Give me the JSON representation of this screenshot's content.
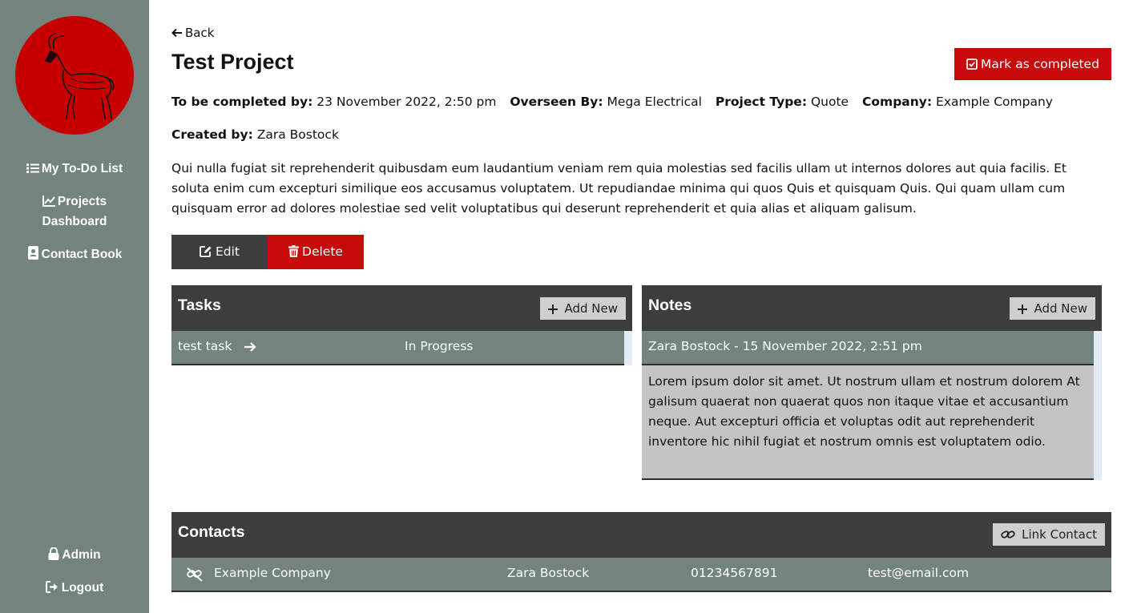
{
  "sidebar": {
    "logo_alt": "antelope-logo",
    "items": [
      {
        "label": "My To-Do List",
        "icon": "list-icon"
      },
      {
        "label_line1": "Projects",
        "label_line2": "Dashboard",
        "icon": "chart-line-icon"
      },
      {
        "label": "Contact Book",
        "icon": "address-book-icon"
      }
    ],
    "admin_label": "Admin",
    "logout_label": "Logout"
  },
  "header": {
    "back_label": "Back",
    "title": "Test Project",
    "mark_completed_label": "Mark as completed"
  },
  "meta": {
    "completed_by_label": "To be completed by:",
    "completed_by_value": "23 November 2022, 2:50 pm",
    "overseen_label": "Overseen By:",
    "overseen_value": "Mega Electrical",
    "type_label": "Project Type:",
    "type_value": "Quote",
    "company_label": "Company:",
    "company_value": "Example Company",
    "created_label": "Created by:",
    "created_value": "Zara Bostock"
  },
  "description": "Qui nulla fugiat sit reprehenderit quibusdam eum laudantium veniam rem quia molestias sed facilis ullam ut internos dolores aut quia facilis. Et soluta enim cum excepturi similique eos accusamus voluptatem. Ut repudiandae minima qui quos Quis et quisquam Quis. Qui quam ullam cum quisquam error ad dolores molestiae sed velit voluptatibus qui deserunt reprehenderit et quia alias et aliquam galisum.",
  "actions": {
    "edit_label": "Edit",
    "delete_label": "Delete"
  },
  "tasks": {
    "title": "Tasks",
    "add_label": "Add New",
    "rows": [
      {
        "name": "test task",
        "status": "In Progress"
      }
    ]
  },
  "notes": {
    "title": "Notes",
    "add_label": "Add New",
    "items": [
      {
        "header": "Zara Bostock - 15 November 2022, 2:51 pm",
        "body": "Lorem ipsum dolor sit amet. Ut nostrum ullam et nostrum dolorem At galisum quaerat non quaerat quos non itaque vitae et accusantium neque. Aut excepturi officia et voluptas odit aut reprehenderit inventore hic nihil fugiat et nostrum omnis est voluptatem odio."
      }
    ]
  },
  "contacts": {
    "title": "Contacts",
    "link_label": "Link Contact",
    "rows": [
      {
        "company": "Example Company",
        "name": "Zara Bostock",
        "phone": "01234567891",
        "email": "test@email.com"
      }
    ]
  },
  "colors": {
    "sidebar": "#73847e",
    "accent_red": "#c90a0a",
    "panel_dark": "#3d3d3d",
    "row_green": "#73847e",
    "note_grey": "#c4c4c4"
  }
}
